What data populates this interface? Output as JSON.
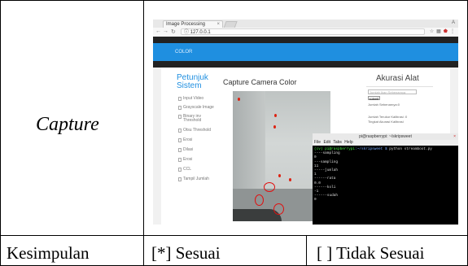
{
  "table": {
    "row_label": "Capture",
    "conclusion_label": "Kesimpulan",
    "option_yes": "[*] Sesuai",
    "option_no": "[ ] Tidak Sesuai"
  },
  "browser": {
    "tab_title": "Image Processing",
    "tab_close": "×",
    "url": "127.0.0.1",
    "window_controls": "A"
  },
  "site": {
    "brand": "COLOR",
    "sidebar_title_line1": "Petunjuk",
    "sidebar_title_line2": "Sistem",
    "sidebar_items": [
      {
        "label": "Input Video"
      },
      {
        "label": "Grayscale Image"
      },
      {
        "label": "Binary inv"
      },
      {
        "label": "Threshold"
      },
      {
        "label": "Otsu Threshold"
      },
      {
        "label": "Erosi"
      },
      {
        "label": "Dilasi"
      },
      {
        "label": "Erosi"
      },
      {
        "label": "CCL"
      },
      {
        "label": "Tampil Jumlah"
      }
    ],
    "main_title": "Capture Camera Color",
    "accuracy_title": "Akurasi Alat",
    "accuracy_input_placeholder": "Jumlah Ikan Sebenarnya",
    "submit_label": "submit",
    "accuracy_line1": "Jumlah Sebenarnya:0",
    "accuracy_line2": "Jumlah Terukur Kalibrasi :0",
    "accuracy_line3": "Tingkat Akurasi Kalibrasi"
  },
  "terminal": {
    "title": "pi@raspberrypi: ~/skripsweet",
    "menu": "File  Edit  Tabs  Help",
    "prompt_user": "(cv) pi@raspberrypi",
    "prompt_path": ":~/skripsweet $",
    "command": " python streamboot.py",
    "lines": [
      "----sampling",
      "0",
      "---sampling",
      "11",
      "-----jumlah",
      "1",
      "------rata",
      "0.0",
      "------koli",
      "-1",
      "------sudah",
      "0"
    ]
  }
}
